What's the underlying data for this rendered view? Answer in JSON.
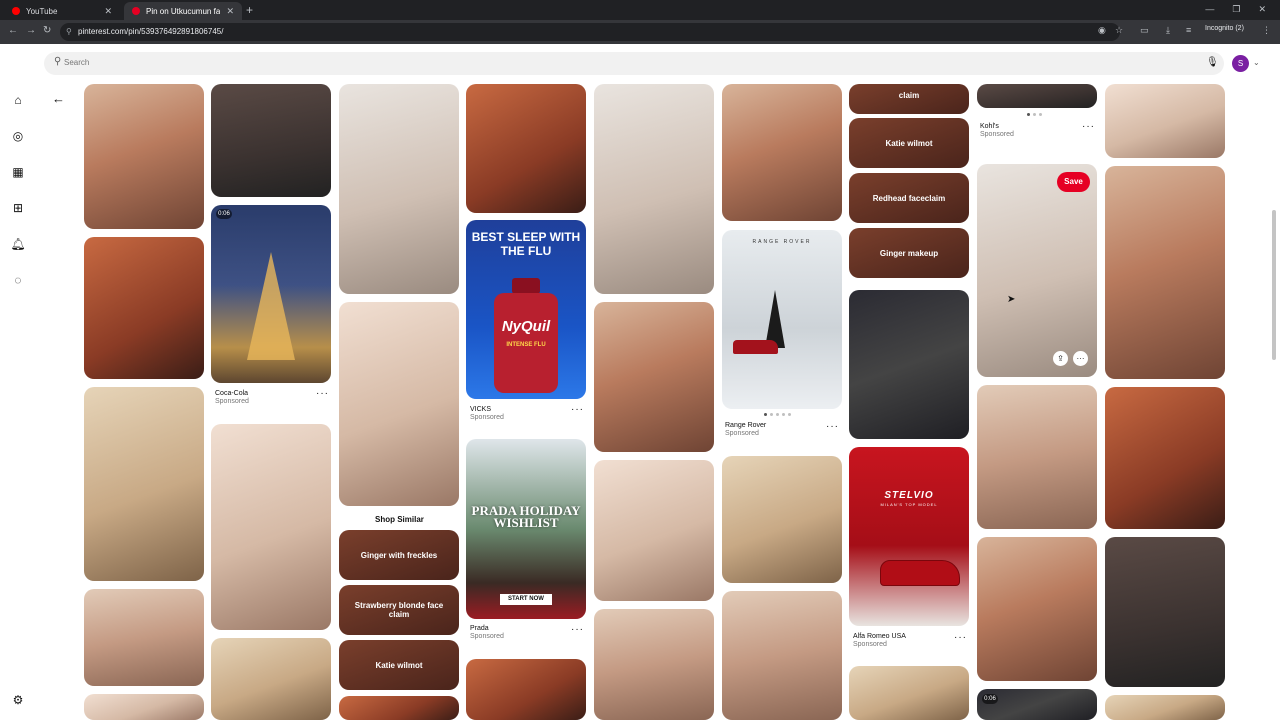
{
  "browser": {
    "tabs": [
      {
        "title": "YouTube",
        "favicon_color": "#ff0000",
        "active": false
      },
      {
        "title": "Pin on Utkucumun favorisi",
        "favicon_color": "#e60023",
        "active": true
      }
    ],
    "url": "pinterest.com/pin/539376492891806745/",
    "incognito_label": "Incognito (2)"
  },
  "pinterest": {
    "brand_color": "#e60023",
    "search_placeholder": "Search",
    "avatar_letter": "S",
    "rail_icons": [
      "pinterest-logo",
      "home-icon",
      "explore-icon",
      "boards-icon",
      "create-icon",
      "notifications-icon",
      "messages-icon",
      "settings-icon"
    ]
  },
  "feed": {
    "shop_similar": "Shop Similar",
    "col3_chips": [
      "Ginger with freckles",
      "Strawberry blonde face claim",
      "Katie wilmot"
    ],
    "col7_chips": [
      "claim",
      "Katie wilmot",
      "Redhead faceclaim",
      "Ginger makeup"
    ],
    "save_label": "Save",
    "video_badges": [
      "0:06",
      "0:06"
    ],
    "ads": {
      "coke": {
        "brand": "Coca-Cola",
        "sponsored": "Sponsored"
      },
      "vicks": {
        "brand": "VICKS",
        "sponsored": "Sponsored",
        "headline": "BEST SLEEP WITH THE FLU",
        "product": "NyQuil",
        "product_sub": "INTENSE FLU"
      },
      "prada": {
        "brand": "Prada",
        "sponsored": "Sponsored",
        "headline": "PRADA HOLIDAY WISHLIST",
        "cta": "START NOW"
      },
      "rangerover": {
        "brand": "Range Rover",
        "sponsored": "Sponsored",
        "logo": "RANGE ROVER"
      },
      "alfa": {
        "brand": "Alfa Romeo USA",
        "sponsored": "Sponsored",
        "headline": "STELVIO",
        "sub": "MILAN'S TOP MODEL"
      },
      "kohls": {
        "brand": "Kohl's",
        "sponsored": "Sponsored"
      }
    }
  }
}
